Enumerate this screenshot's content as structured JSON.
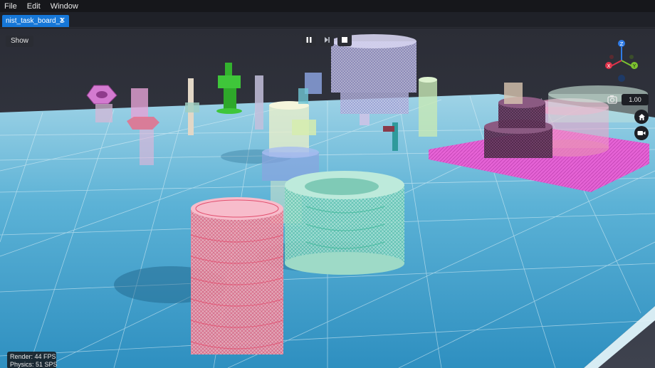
{
  "menu": {
    "items": [
      "File",
      "Edit",
      "Window"
    ]
  },
  "tab": {
    "label": "nist_task_board_1",
    "close": "✕"
  },
  "viewport": {
    "show_label": "Show",
    "zoom_value": "1.00",
    "axes": {
      "z": "Z",
      "x": "X",
      "y": "Y"
    },
    "axis_colors": {
      "z": "#2f7be6",
      "x": "#e0334a",
      "y": "#7cc230"
    }
  },
  "stats": {
    "render_label": "Render:",
    "render_value": "44 FPS",
    "physics_label": "Physics:",
    "physics_value": "51 SPS"
  }
}
